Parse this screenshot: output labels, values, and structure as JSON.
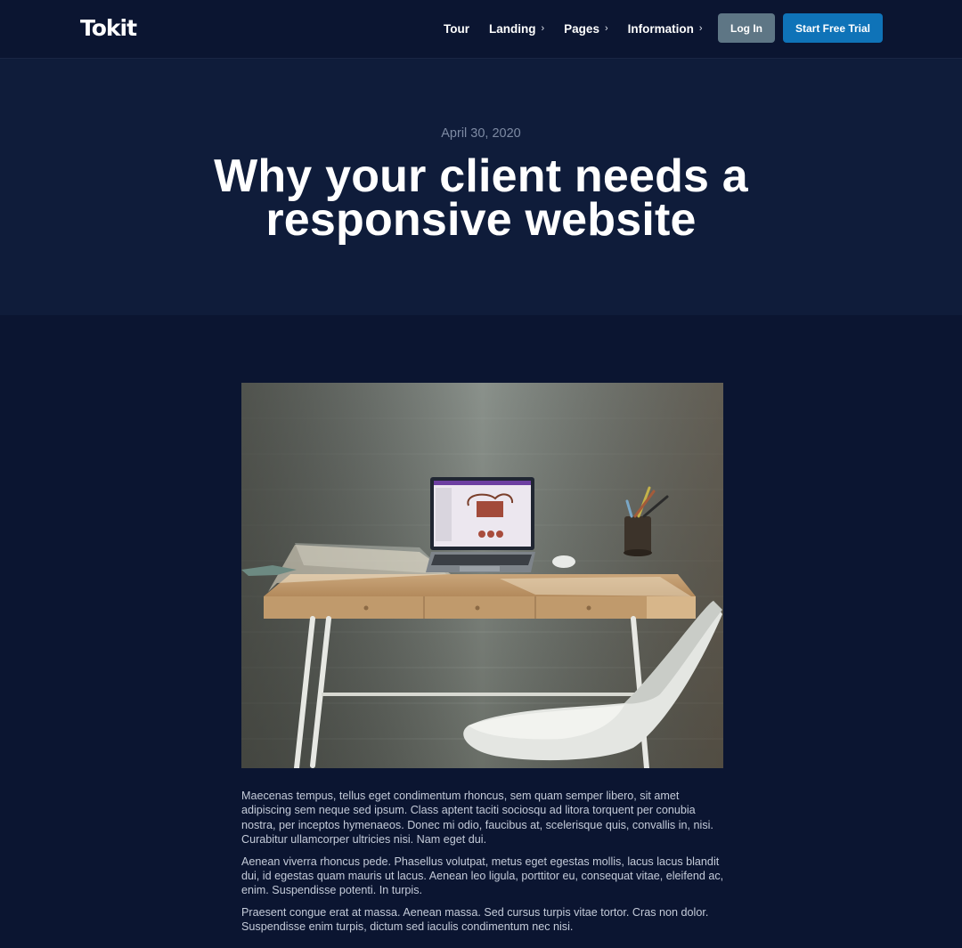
{
  "header": {
    "logo": "Tokit",
    "nav": [
      {
        "label": "Tour",
        "has_chevron": false
      },
      {
        "label": "Landing",
        "has_chevron": true
      },
      {
        "label": "Pages",
        "has_chevron": true
      },
      {
        "label": "Information",
        "has_chevron": true
      }
    ],
    "chevron_glyph": "›",
    "login_label": "Log In",
    "trial_label": "Start Free Trial"
  },
  "hero": {
    "date": "April 30, 2020",
    "title": "Why your client needs a responsive website"
  },
  "article": {
    "image_icon": "desk-photo",
    "paragraphs": [
      "Maecenas tempus, tellus eget condimentum rhoncus, sem quam semper libero, sit amet adipiscing sem neque sed ipsum. Class aptent taciti sociosqu ad litora torquent per conubia nostra, per inceptos hymenaeos. Donec mi odio, faucibus at, scelerisque quis, convallis in, nisi. Curabitur ullamcorper ultricies nisi. Nam eget dui.",
      "Aenean viverra rhoncus pede. Phasellus volutpat, metus eget egestas mollis, lacus lacus blandit dui, id egestas quam mauris ut lacus. Aenean leo ligula, porttitor eu, consequat vitae, eleifend ac, enim. Suspendisse potenti. In turpis.",
      "Praesent congue erat at massa. Aenean massa. Sed cursus turpis vitae tortor. Cras non dolor. Suspendisse enim turpis, dictum sed iaculis condimentum nec nisi."
    ]
  },
  "colors": {
    "page_bg": "#0b1531",
    "hero_bg": "#0f1c3a",
    "login_bg": "#5e7685",
    "trial_bg": "#0f73b8",
    "date_text": "#7d8aa3",
    "body_text": "#c4cbd9"
  }
}
